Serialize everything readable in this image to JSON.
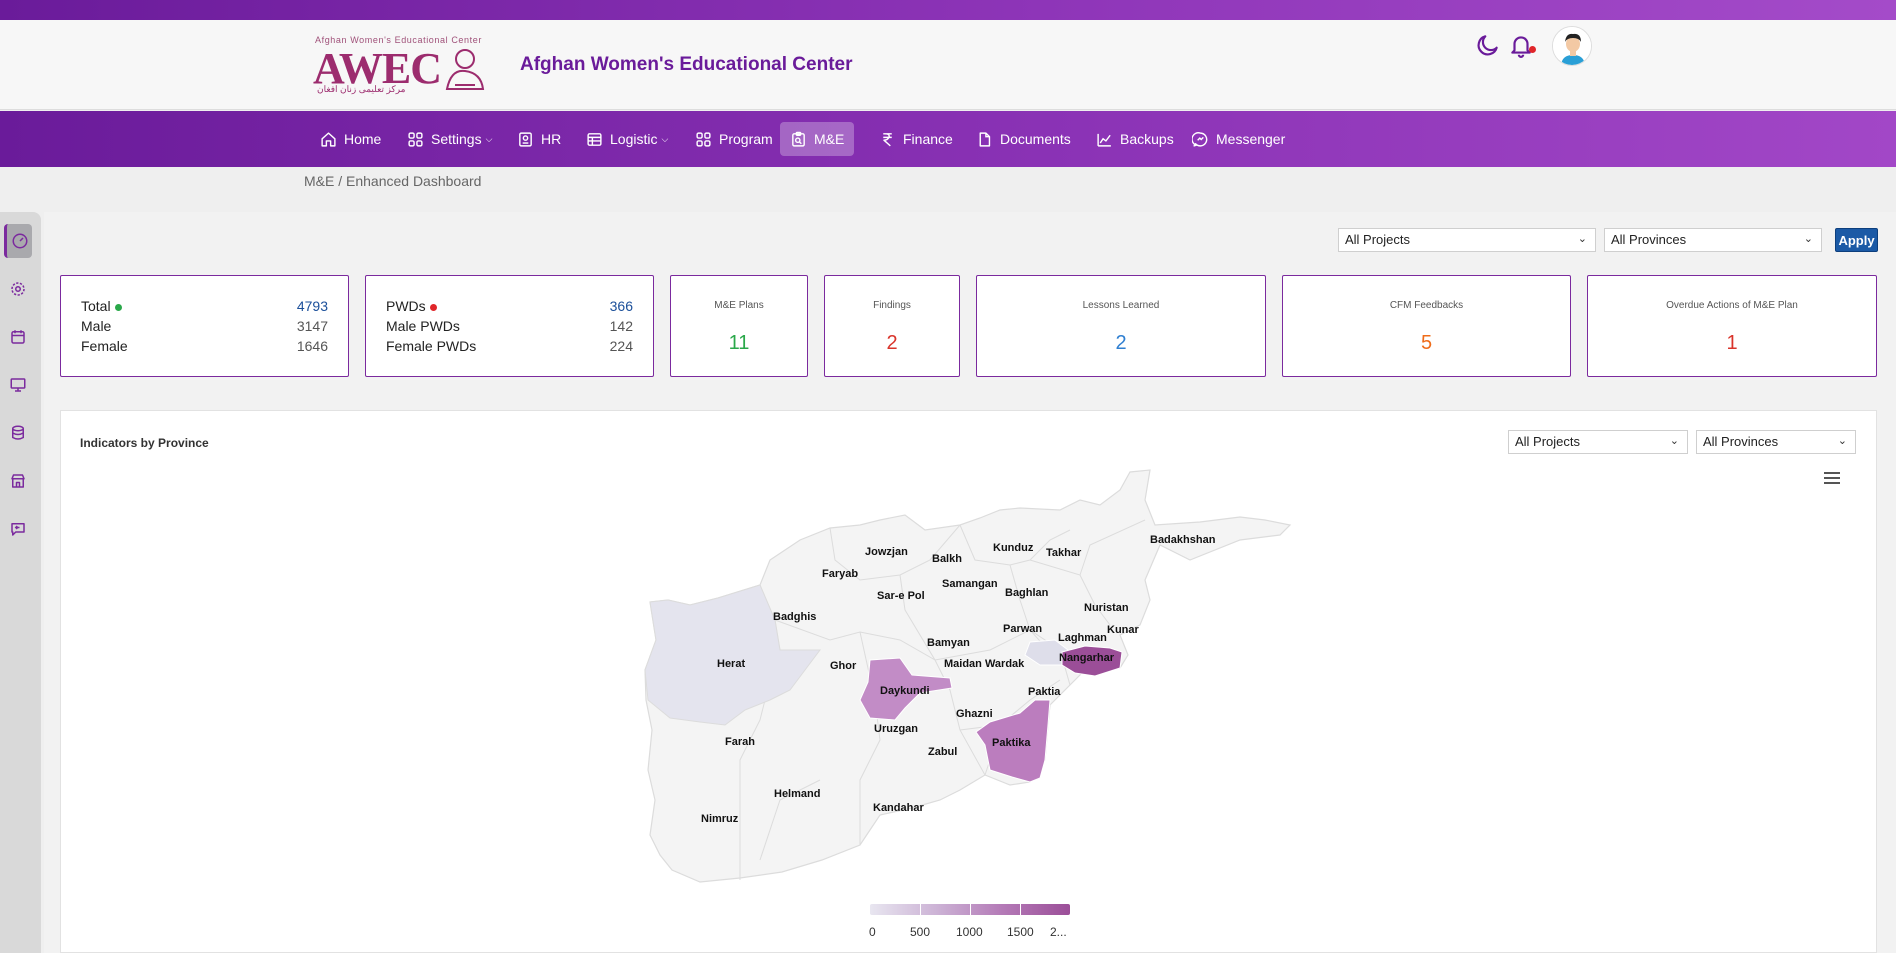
{
  "header": {
    "logo_tagline": "Afghan Women's Educational Center",
    "logo_text": "AWEC",
    "logo_arabic": "مرکز تعلیمی زنان افغان",
    "title": "Afghan Women's Educational Center"
  },
  "nav": {
    "items": [
      {
        "label": "Home",
        "icon": "home-icon"
      },
      {
        "label": "Settings",
        "icon": "grid-icon",
        "dropdown": true
      },
      {
        "label": "HR",
        "icon": "id-card-icon"
      },
      {
        "label": "Logistic",
        "icon": "table-icon",
        "dropdown": true
      },
      {
        "label": "Program",
        "icon": "grid-icon"
      },
      {
        "label": "M&E",
        "icon": "clipboard-icon",
        "active": true
      },
      {
        "label": "Finance",
        "icon": "rupee-icon"
      },
      {
        "label": "Documents",
        "icon": "document-icon"
      },
      {
        "label": "Backups",
        "icon": "chart-icon"
      },
      {
        "label": "Messenger",
        "icon": "chat-icon"
      }
    ]
  },
  "breadcrumb": "M&E / Enhanced Dashboard",
  "filters": {
    "project": "All Projects",
    "province": "All Provinces",
    "apply_label": "Apply"
  },
  "summary": {
    "beneficiaries": [
      {
        "label": "Total",
        "value": "4793",
        "dot": "#2aa84a"
      },
      {
        "label": "Male",
        "value": "3147"
      },
      {
        "label": "Female",
        "value": "1646"
      }
    ],
    "pwds": [
      {
        "label": "PWDs",
        "value": "366",
        "dot": "#e0262a"
      },
      {
        "label": "Male PWDs",
        "value": "142"
      },
      {
        "label": "Female PWDs",
        "value": "224"
      }
    ],
    "stats": [
      {
        "title": "M&E Plans",
        "value": "11",
        "color": "#2aa84a"
      },
      {
        "title": "Findings",
        "value": "2",
        "color": "#d9342b"
      },
      {
        "title": "Lessons Learned",
        "value": "2",
        "color": "#2f7fd1"
      },
      {
        "title": "CFM Feedbacks",
        "value": "5",
        "color": "#ef6c1a"
      },
      {
        "title": "Overdue Actions of M&E Plan",
        "value": "1",
        "color": "#d9342b"
      }
    ]
  },
  "map_panel": {
    "title": "Indicators by Province",
    "project_filter": "All Projects",
    "province_filter": "All Provinces",
    "provinces": [
      "Badakhshan",
      "Jowzjan",
      "Balkh",
      "Kunduz",
      "Takhar",
      "Faryab",
      "Samangan",
      "Sar-e Pol",
      "Baghlan",
      "Badghis",
      "Nuristan",
      "Parwan",
      "Kunar",
      "Bamyan",
      "Laghman",
      "Herat",
      "Ghor",
      "Maidan Wardak",
      "Nangarhar",
      "Daykundi",
      "Paktia",
      "Ghazni",
      "Uruzgan",
      "Farah",
      "Paktika",
      "Zabul",
      "Helmand",
      "Kandahar",
      "Nimruz"
    ],
    "legend": [
      "0",
      "500",
      "1000",
      "1500",
      "2..."
    ],
    "colors": {
      "low": "#e8e6f0",
      "mid": "#b57cb8",
      "high": "#9b4e98"
    }
  }
}
